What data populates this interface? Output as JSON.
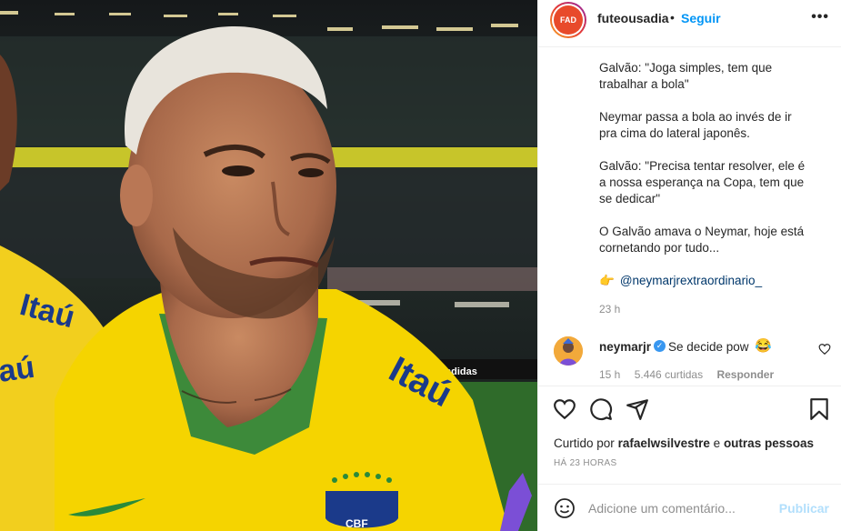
{
  "post": {
    "username": "futeousadia",
    "avatar_text": "FAD",
    "separator": "•",
    "follow_label": "Seguir",
    "more_label": "•••",
    "photo_text": {
      "left_shirt_1": "Itaú",
      "left_shirt_2": "aú",
      "main_shirt": "Itaú",
      "crest": "CBF",
      "adidas": "adidas"
    },
    "caption": {
      "paragraphs": [
        "Galvão: \"Joga simples, tem que trabalhar a bola\"",
        "Neymar passa a bola ao invés de ir pra cima do lateral japonês.",
        "Galvão: \"Precisa tentar resolver, ele é a nossa esperança na Copa, tem que se dedicar\"",
        "O Galvão amava o Neymar, hoje está cornetando por tudo..."
      ],
      "mention_emoji": "👉",
      "mention": "@neymarjrextraordinario_"
    },
    "time": "23 h"
  },
  "comment": {
    "username": "neymarjr",
    "verified_mark": "✓",
    "text": "Se decide pow",
    "emoji": "😂",
    "time": "15 h",
    "likes": "5.446 curtidas",
    "reply_label": "Responder"
  },
  "actions": {
    "like_icon": "heart-icon",
    "comment_icon": "comment-icon",
    "share_icon": "share-icon",
    "save_icon": "bookmark-icon"
  },
  "likes": {
    "prefix": "Curtido por",
    "user": "rafaelwsilvestre",
    "connector": "e",
    "suffix": "outras pessoas"
  },
  "post_age": "HÁ 23 HORAS",
  "add_comment": {
    "placeholder": "Adicione um comentário...",
    "publish_label": "Publicar"
  },
  "colors": {
    "accent": "#0095f6",
    "mention": "#00376b",
    "publish_disabled": "#b2dffc",
    "muted": "#8e8e8e",
    "shirt_yellow": "#f5d400"
  }
}
